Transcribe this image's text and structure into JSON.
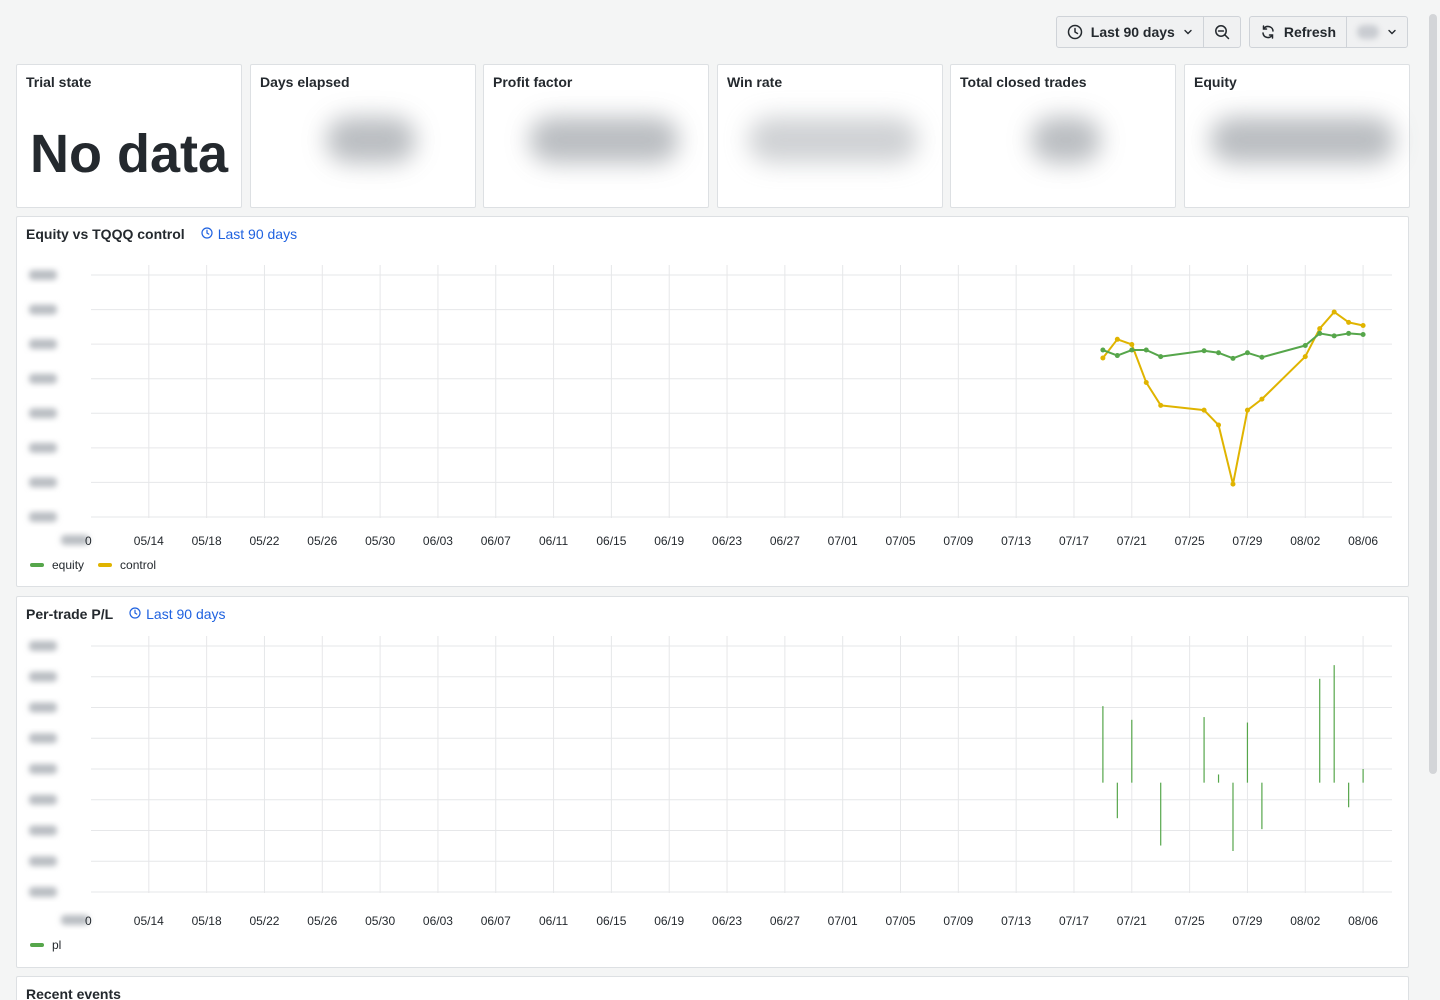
{
  "toolbar": {
    "time_range_label": "Last 90 days",
    "refresh_label": "Refresh"
  },
  "stats": [
    {
      "title": "Trial state",
      "value": "No data",
      "blurred": false
    },
    {
      "title": "Days elapsed",
      "value": null,
      "blurred": true
    },
    {
      "title": "Profit factor",
      "value": null,
      "blurred": true
    },
    {
      "title": "Win rate",
      "value": null,
      "blurred": true
    },
    {
      "title": "Total closed trades",
      "value": null,
      "blurred": true
    },
    {
      "title": "Equity",
      "value": null,
      "blurred": true
    }
  ],
  "equity_panel": {
    "title": "Equity vs TQQQ control",
    "time_label": "Last 90 days"
  },
  "pl_panel": {
    "title": "Per-trade P/L",
    "time_label": "Last 90 days"
  },
  "events_panel": {
    "title": "Recent events"
  },
  "colors": {
    "equity": "#56a64b",
    "control": "#e0b400",
    "pl": "#56a64b",
    "link": "#1f62e0"
  },
  "chart_data": [
    {
      "type": "line",
      "x_ticks": [
        "05/14",
        "05/18",
        "05/22",
        "05/26",
        "05/30",
        "06/03",
        "06/07",
        "06/11",
        "06/15",
        "06/19",
        "06/23",
        "06/27",
        "07/01",
        "07/05",
        "07/09",
        "07/13",
        "07/17",
        "07/21",
        "07/25",
        "07/29",
        "08/02",
        "08/06"
      ],
      "x_range": [
        "05/10",
        "08/08"
      ],
      "y_ticks_hidden": true,
      "grid": true,
      "legend_position": "bottom-left",
      "series": [
        {
          "name": "equity",
          "x": [
            "07/19",
            "07/20",
            "07/21",
            "07/22",
            "07/23",
            "07/26",
            "07/27",
            "07/28",
            "07/29",
            "07/30",
            "08/02",
            "08/03",
            "08/04",
            "08/05",
            "08/06"
          ],
          "y": [
            4.83,
            4.67,
            4.83,
            4.83,
            4.64,
            4.81,
            4.75,
            4.59,
            4.75,
            4.62,
            4.96,
            5.31,
            5.24,
            5.31,
            5.28
          ]
        },
        {
          "name": "control",
          "x": [
            "07/19",
            "07/20",
            "07/21",
            "07/22",
            "07/23",
            "07/26",
            "07/27",
            "07/28",
            "07/29",
            "07/30",
            "08/02",
            "08/03",
            "08/04",
            "08/05",
            "08/06"
          ],
          "y": [
            4.6,
            5.14,
            4.99,
            3.89,
            3.23,
            3.09,
            2.66,
            0.95,
            3.09,
            3.41,
            4.64,
            5.45,
            5.93,
            5.63,
            5.54
          ]
        }
      ],
      "y_range": [
        0,
        7
      ]
    },
    {
      "type": "bar",
      "x_ticks": [
        "05/14",
        "05/18",
        "05/22",
        "05/26",
        "05/30",
        "06/03",
        "06/07",
        "06/11",
        "06/15",
        "06/19",
        "06/23",
        "06/27",
        "07/01",
        "07/05",
        "07/09",
        "07/13",
        "07/17",
        "07/21",
        "07/25",
        "07/29",
        "08/02",
        "08/06"
      ],
      "x_range": [
        "05/10",
        "08/08"
      ],
      "y_ticks_hidden": true,
      "grid": true,
      "legend_position": "bottom-left",
      "series": [
        {
          "name": "pl",
          "x": [
            "07/19",
            "07/20",
            "07/21",
            "07/23",
            "07/26",
            "07/27",
            "07/28",
            "07/29",
            "07/30",
            "08/03",
            "08/04",
            "08/05",
            "08/06"
          ],
          "values": [
            2.8,
            -1.3,
            2.3,
            -2.3,
            2.4,
            0.3,
            -2.5,
            2.2,
            -1.7,
            3.8,
            4.3,
            -0.9,
            0.5
          ]
        }
      ],
      "y_range": [
        -4,
        5
      ]
    }
  ]
}
